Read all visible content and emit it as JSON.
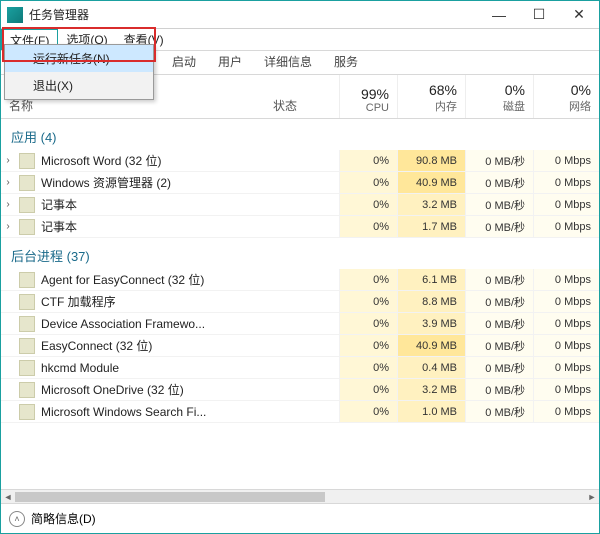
{
  "titlebar": {
    "title": "任务管理器"
  },
  "menubar": {
    "file": "文件(F)",
    "options": "选项(O)",
    "view": "查看(V)"
  },
  "dropdown": {
    "run_new": "运行新任务(N)",
    "exit": "退出(X)"
  },
  "tabs": {
    "startup": "启动",
    "users": "用户",
    "details": "详细信息",
    "services": "服务"
  },
  "headers": {
    "name": "名称",
    "state": "状态",
    "cpu_pct": "99%",
    "cpu_lbl": "CPU",
    "mem_pct": "68%",
    "mem_lbl": "内存",
    "disk_pct": "0%",
    "disk_lbl": "磁盘",
    "net_pct": "0%",
    "net_lbl": "网络"
  },
  "groups": {
    "apps": "应用 (4)",
    "bg": "后台进程 (37)"
  },
  "apps": [
    {
      "name": "Microsoft Word (32 位)",
      "cpu": "0%",
      "mem": "90.8 MB",
      "disk": "0 MB/秒",
      "net": "0 Mbps",
      "exp": true,
      "mem_high": true
    },
    {
      "name": "Windows 资源管理器 (2)",
      "cpu": "0%",
      "mem": "40.9 MB",
      "disk": "0 MB/秒",
      "net": "0 Mbps",
      "exp": true,
      "mem_high": true
    },
    {
      "name": "记事本",
      "cpu": "0%",
      "mem": "3.2 MB",
      "disk": "0 MB/秒",
      "net": "0 Mbps",
      "exp": true
    },
    {
      "name": "记事本",
      "cpu": "0%",
      "mem": "1.7 MB",
      "disk": "0 MB/秒",
      "net": "0 Mbps",
      "exp": true
    }
  ],
  "bg": [
    {
      "name": "Agent for EasyConnect (32 位)",
      "cpu": "0%",
      "mem": "6.1 MB",
      "disk": "0 MB/秒",
      "net": "0 Mbps"
    },
    {
      "name": "CTF 加载程序",
      "cpu": "0%",
      "mem": "8.8 MB",
      "disk": "0 MB/秒",
      "net": "0 Mbps"
    },
    {
      "name": "Device Association Framewo...",
      "cpu": "0%",
      "mem": "3.9 MB",
      "disk": "0 MB/秒",
      "net": "0 Mbps"
    },
    {
      "name": "EasyConnect (32 位)",
      "cpu": "0%",
      "mem": "40.9 MB",
      "disk": "0 MB/秒",
      "net": "0 Mbps",
      "mem_high": true
    },
    {
      "name": "hkcmd Module",
      "cpu": "0%",
      "mem": "0.4 MB",
      "disk": "0 MB/秒",
      "net": "0 Mbps"
    },
    {
      "name": "Microsoft OneDrive (32 位)",
      "cpu": "0%",
      "mem": "3.2 MB",
      "disk": "0 MB/秒",
      "net": "0 Mbps"
    },
    {
      "name": "Microsoft Windows Search Fi...",
      "cpu": "0%",
      "mem": "1.0 MB",
      "disk": "0 MB/秒",
      "net": "0 Mbps"
    }
  ],
  "footer": {
    "fewer": "简略信息(D)"
  },
  "glyphs": {
    "min": "—",
    "max": "☐",
    "close": "✕",
    "chev": "›",
    "up": "˄",
    "left": "◄",
    "right": "►"
  }
}
